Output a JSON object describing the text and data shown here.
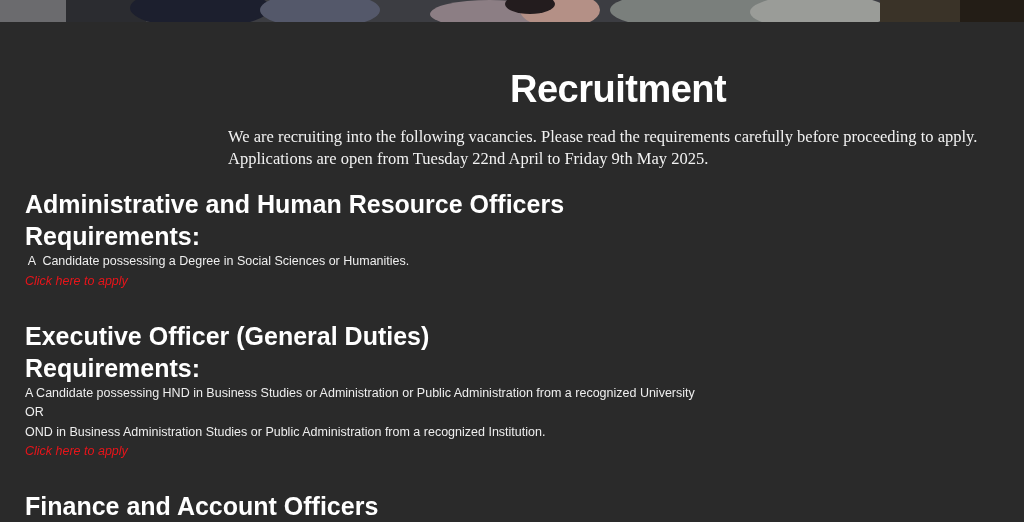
{
  "banner": {
    "kind": "picture"
  },
  "title": "Recruitment",
  "intro": [
    "We are recruiting into the following vacancies. Please read the requirements carefully before proceeding to apply.",
    "Applications are open from Tuesday 22nd April to Friday 9th May 2025."
  ],
  "vacancies": [
    {
      "title": "Administrative and Human Resource Officers",
      "requirements_label": "Requirements:",
      "requirements": [
        " A  Candidate possessing a Degree in Social Sciences or Humanities."
      ],
      "link": "Click here to apply"
    },
    {
      "title": "Executive Officer (General Duties)",
      "requirements_label": "Requirements:",
      "requirements": [
        "A Candidate possessing HND in Business Studies or Administration or Public Administration from a recognized University",
        "OR",
        "OND in Business Administration Studies or Public Administration from a recognized Institution."
      ],
      "link": "Click here to apply"
    },
    {
      "title": "Finance and Account Officers"
    }
  ]
}
